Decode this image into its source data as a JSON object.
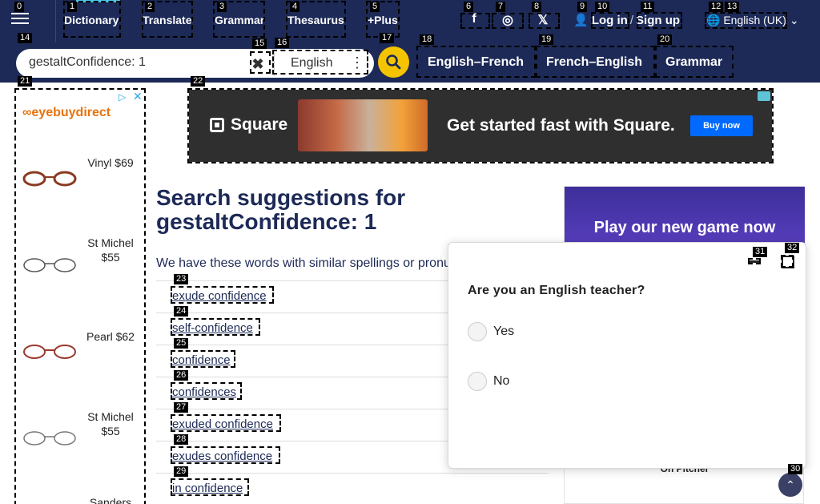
{
  "nav": {
    "menu_icon": "hamburger-icon",
    "links": [
      "Dictionary",
      "Translate",
      "Grammar",
      "Thesaurus",
      "+Plus"
    ],
    "social_icons": [
      "facebook-icon",
      "instagram-icon",
      "x-icon"
    ],
    "social_glyphs": [
      "f",
      "◎",
      "𝕏"
    ],
    "login": "Log in",
    "login_sep": "/",
    "signup": "Sign up",
    "language": "English (UK)"
  },
  "search": {
    "value": "gestaltConfidence: 1",
    "clear_glyph": "✖",
    "dictionary": "English",
    "kebab_glyph": "⋮",
    "quick_links": [
      "English–French",
      "French–English",
      "Grammar"
    ]
  },
  "left_ad": {
    "brand": "eyebuydirect",
    "adchoices_glyph": "▷",
    "close_glyph": "✕",
    "products": [
      {
        "name": "Vinyl $69",
        "frame_color": "#8a3a20"
      },
      {
        "name": "St Michel $55",
        "frame_color": "#555555"
      },
      {
        "name": "Pearl $62",
        "frame_color": "#9a3a2e"
      },
      {
        "name": "St Michel $55",
        "frame_color": "#777777"
      },
      {
        "name": "Sanders",
        "frame_color": "#333333"
      }
    ]
  },
  "banner": {
    "brand": "Square",
    "headline": "Get started fast with Square.",
    "cta": "Buy now"
  },
  "main": {
    "heading_line1": "Search suggestions for",
    "heading_line2": "gestaltConfidence: 1",
    "intro": "We have these words with similar spellings or pronunciations",
    "suggestions": [
      "exude confidence",
      "self-confidence",
      "confidence",
      "confidences",
      "exuded confidence",
      "exudes confidence",
      "in confidence"
    ]
  },
  "right_ad": {
    "headline": "Play our new game now",
    "sub": "On Pitcher"
  },
  "survey": {
    "question": "Are you an English teacher?",
    "options": [
      "Yes",
      "No"
    ]
  },
  "scroll_top_glyph": "⌃",
  "colors": {
    "navy": "#1d2a57",
    "search_button": "#f5c400",
    "accent": "#4bc8e8"
  }
}
